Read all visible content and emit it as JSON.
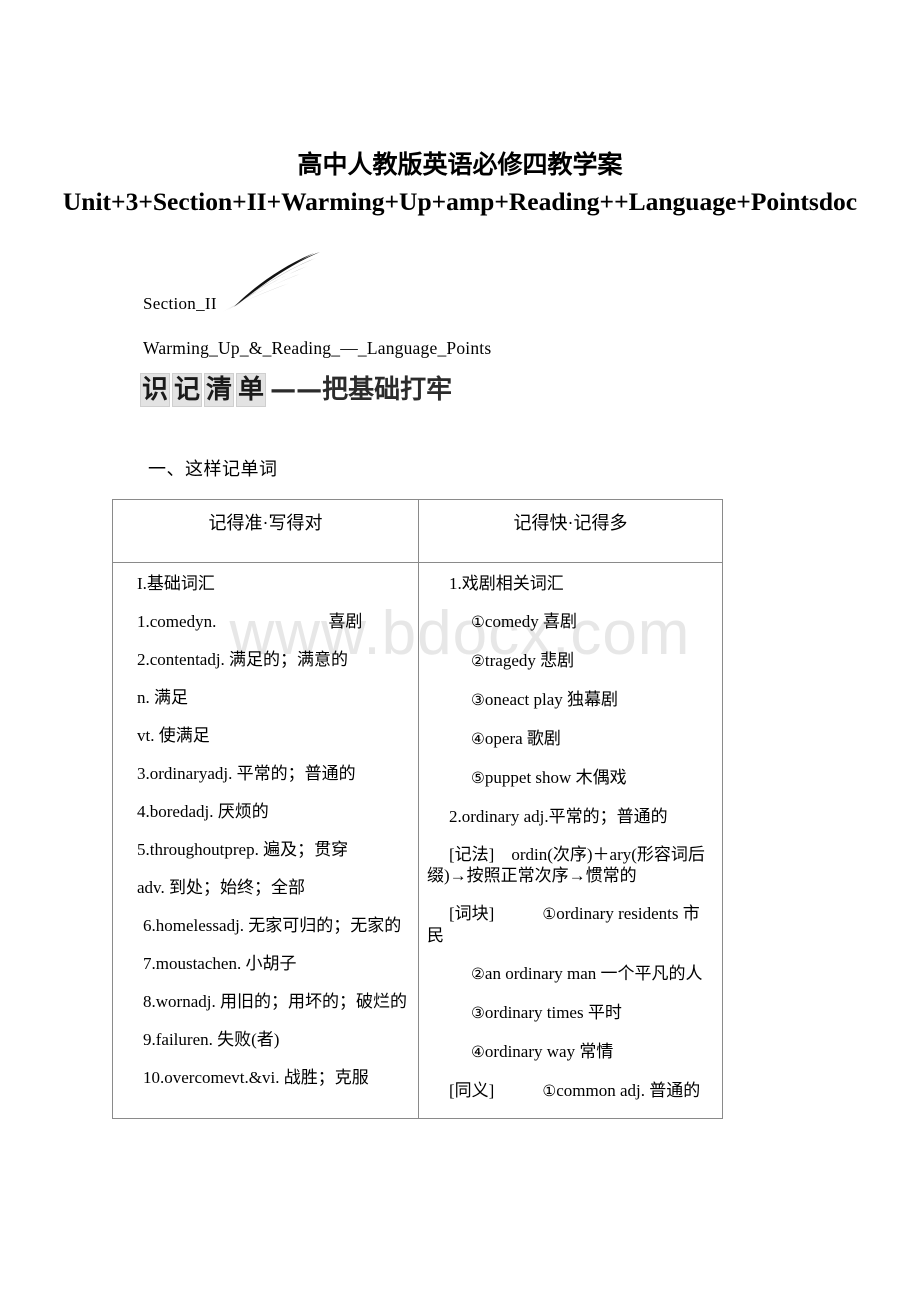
{
  "watermark": "www.bdocx.com",
  "title": {
    "line_cn": "高中人教版英语必修四教学案",
    "line_en": "Unit+3+Section+II+Warming+Up+amp+Reading++Language+Pointsdoc"
  },
  "section": {
    "label": "Section_II",
    "subtitle": "Warming_Up_&_Reading_—_Language_Points",
    "boxed_chars": [
      "识",
      "记",
      "清",
      "单"
    ],
    "boxed_tail": "——把基础打牢"
  },
  "list_heading": "一、这样记单词",
  "table": {
    "headers": [
      "记得准·写得对",
      "记得快·记得多"
    ],
    "left_column": [
      {
        "text": "I.基础词汇",
        "style": "plain"
      },
      {
        "text": "1.comedyn.",
        "trailing": "喜剧",
        "style": "gap"
      },
      {
        "text": "2.contentadj. 满足的；满意的",
        "style": "plain"
      },
      {
        "text": "n. 满足",
        "style": "plain"
      },
      {
        "text": "vt. 使满足",
        "style": "plain"
      },
      {
        "text": "3.ordinaryadj. 平常的；普通的",
        "style": "plain"
      },
      {
        "text": "4.boredadj. 厌烦的",
        "style": "plain"
      },
      {
        "text": "5.throughoutprep. 遍及；贯穿",
        "style": "plain"
      },
      {
        "text": "adv. 到处；始终；全部",
        "style": "plain"
      },
      {
        "text": "6.homelessadj. 无家可归的；无家的",
        "style": "wide"
      },
      {
        "text": "7.moustachen. 小胡子",
        "style": "wide"
      },
      {
        "text": "8.wornadj. 用旧的；用坏的；破烂的",
        "style": "wide"
      },
      {
        "text": "9.failuren. 失败(者)",
        "style": "wide"
      },
      {
        "text": "10.overcomevt.&vi. 战胜；克服",
        "style": "wide"
      }
    ],
    "right_column": [
      {
        "text": "1.戏剧相关词汇",
        "style": "wide"
      },
      {
        "circle": "①",
        "text": "comedy 喜剧",
        "style": "wide"
      },
      {
        "circle": "②",
        "text": "tragedy 悲剧",
        "style": "wide"
      },
      {
        "circle": "③",
        "text": "oneact play 独幕剧",
        "style": "wide"
      },
      {
        "circle": "④",
        "text": "opera 歌剧",
        "style": "wide"
      },
      {
        "circle": "⑤",
        "text": "puppet show 木偶戏",
        "style": "wide"
      },
      {
        "text": "2.ordinary adj.平常的；普通的",
        "style": "wide"
      },
      {
        "text": "[记法]　ordin(次序)＋ary(形容词后缀)→按照正常次序→惯常的",
        "style": "wide"
      },
      {
        "circle": "①",
        "label": "[词块]",
        "text": "ordinary residents 市民",
        "style": "wide"
      },
      {
        "circle": "②",
        "text": "an ordinary man 一个平凡的人",
        "style": "wide"
      },
      {
        "circle": "③",
        "text": "ordinary times 平时",
        "style": "wide"
      },
      {
        "circle": "④",
        "text": "ordinary way 常情",
        "style": "wide"
      },
      {
        "circle": "①",
        "label": "[同义]",
        "text": "common adj. 普通的",
        "style": "wide"
      }
    ]
  }
}
